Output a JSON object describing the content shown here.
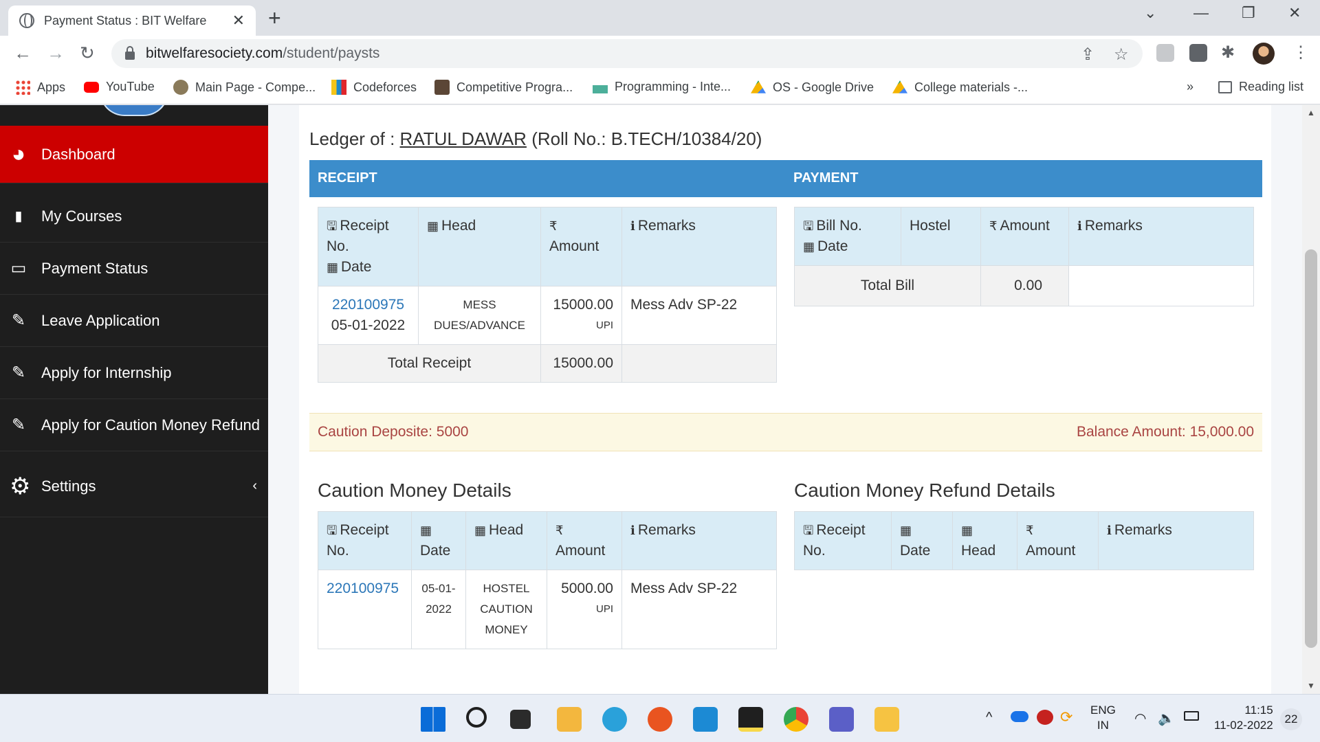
{
  "browser": {
    "tab_title": "Payment Status : BIT Welfare",
    "url_host": "bitwelfaresociety.com",
    "url_path": "/student/paysts",
    "bookmarks": [
      "Apps",
      "YouTube",
      "Main Page - Compe...",
      "Codeforces",
      "Competitive Progra...",
      "Programming - Inte...",
      "OS - Google Drive",
      "College materials -..."
    ],
    "more_bookmarks": "»",
    "reading_list": "Reading list"
  },
  "sidebar": {
    "items": [
      {
        "label": "Dashboard",
        "icon": "dashboard-icon",
        "active": true
      },
      {
        "label": "My Courses",
        "icon": "file-icon"
      },
      {
        "label": "Payment Status",
        "icon": "credit-card-icon"
      },
      {
        "label": "Leave Application",
        "icon": "paperclip-icon"
      },
      {
        "label": "Apply for Internship",
        "icon": "paperclip-icon"
      },
      {
        "label": "Apply for Caution Money Refund",
        "icon": "paperclip-icon"
      },
      {
        "label": "Settings",
        "icon": "gear-icon"
      }
    ]
  },
  "ledger": {
    "prefix": "Ledger of : ",
    "name": "RATUL DAWAR",
    "roll": "(Roll No.: B.TECH/10384/20)"
  },
  "receipt": {
    "title": "RECEIPT",
    "headers": {
      "receipt_no": "Receipt No.",
      "date": "Date",
      "head": "Head",
      "amount": "Amount",
      "remarks": "Remarks"
    },
    "rows": [
      {
        "receipt_no": "220100975",
        "date": "05-01-2022",
        "head": "MESS DUES/ADVANCE",
        "amount": "15000.00",
        "mode": "UPI",
        "remarks": "Mess Adv SP-22"
      }
    ],
    "total_label": "Total Receipt",
    "total_value": "15000.00"
  },
  "payment": {
    "title": "PAYMENT",
    "headers": {
      "bill_no": "Bill No.",
      "date": "Date",
      "hostel": "Hostel",
      "amount": "Amount",
      "remarks": "Remarks"
    },
    "total_label": "Total Bill",
    "total_value": "0.00"
  },
  "summary": {
    "caution_deposit": "Caution Deposite: 5000",
    "balance": "Balance Amount: 15,000.00"
  },
  "caution_details": {
    "title": "Caution Money Details",
    "headers": {
      "receipt_no": "Receipt No.",
      "date": "Date",
      "head": "Head",
      "amount": "Amount",
      "remarks": "Remarks"
    },
    "rows": [
      {
        "receipt_no": "220100975",
        "date": "05-01-2022",
        "head": "HOSTEL CAUTION MONEY",
        "amount": "5000.00",
        "mode": "UPI",
        "remarks": "Mess Adv SP-22"
      }
    ]
  },
  "refund_details": {
    "title": "Caution Money Refund Details",
    "headers": {
      "receipt_no": "Receipt No.",
      "date": "Date",
      "head": "Head",
      "amount": "Amount",
      "remarks": "Remarks"
    }
  },
  "taskbar": {
    "lang": "ENG",
    "region": "IN",
    "time": "11:15",
    "date": "11-02-2022",
    "notifications": "22"
  },
  "colors": {
    "accent": "#3c8dcb",
    "active": "#cc0000",
    "warning_text": "#a94442"
  }
}
